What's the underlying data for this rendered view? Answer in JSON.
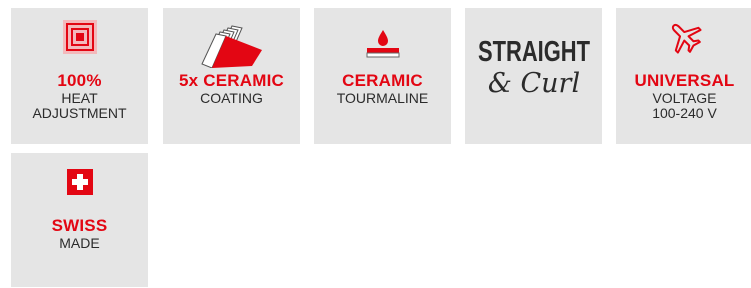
{
  "features": [
    {
      "title": "100%",
      "subtitle": "HEAT\nADJUSTMENT",
      "icon": "heat-squares-icon"
    },
    {
      "title": "5x CERAMIC",
      "subtitle": "COATING",
      "icon": "ceramic-layers-icon"
    },
    {
      "title": "CERAMIC",
      "subtitle": "TOURMALINE",
      "icon": "tourmaline-drop-icon"
    },
    {
      "logo_text_line1": "STRAIGHT",
      "logo_text_line2": "& Curl",
      "icon": "straight-curl-logo"
    },
    {
      "title": "UNIVERSAL",
      "subtitle": "VOLTAGE\n100-240 V",
      "icon": "airplane-icon"
    },
    {
      "title": "SWISS",
      "subtitle": "MADE",
      "icon": "swiss-flag-icon"
    }
  ],
  "colors": {
    "accent": "#e30613",
    "tile": "#e5e5e5",
    "text": "#2b2b2b"
  }
}
